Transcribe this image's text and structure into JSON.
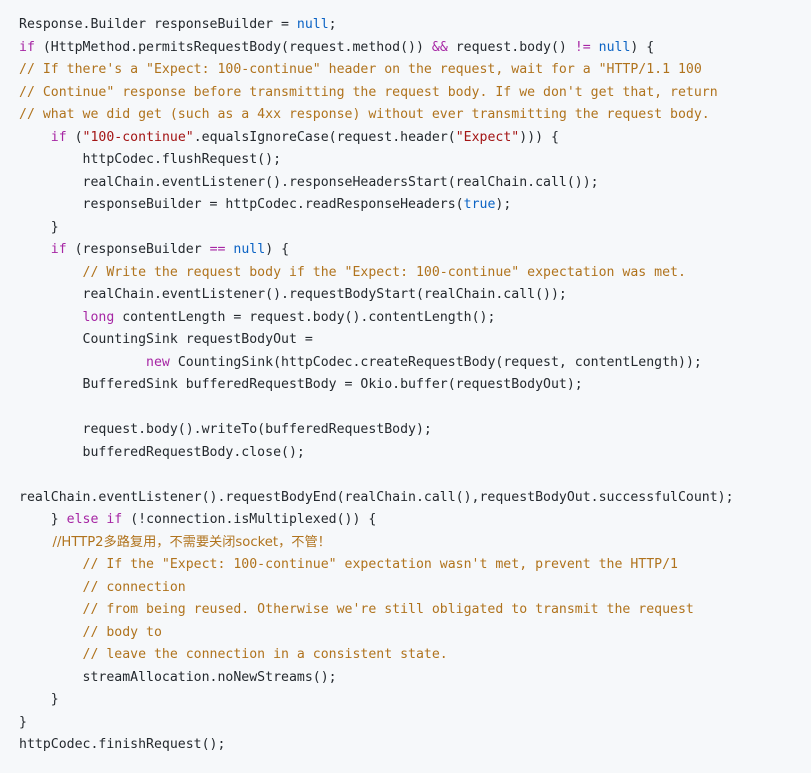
{
  "code": {
    "language": "java",
    "colors": {
      "background": "#f6f8fa",
      "text": "#24292e",
      "keyword": "#a626a4",
      "keyword_blue": "#0b63c4",
      "string": "#a31515",
      "comment": "#b0731d"
    },
    "lines": [
      [
        {
          "t": "Response.Builder responseBuilder = ",
          "c": "plain"
        },
        {
          "t": "null",
          "c": "kw2"
        },
        {
          "t": ";",
          "c": "plain"
        }
      ],
      [
        {
          "t": "if",
          "c": "kw"
        },
        {
          "t": " (HttpMethod.permitsRequestBody(request.method()) ",
          "c": "plain"
        },
        {
          "t": "&&",
          "c": "kw"
        },
        {
          "t": " request.body() ",
          "c": "plain"
        },
        {
          "t": "!=",
          "c": "kw"
        },
        {
          "t": " ",
          "c": "plain"
        },
        {
          "t": "null",
          "c": "kw2"
        },
        {
          "t": ") {",
          "c": "plain"
        }
      ],
      [
        {
          "t": "// If there's a \"Expect: 100-continue\" header on the request, wait for a \"HTTP/1.1 100",
          "c": "cmt"
        }
      ],
      [
        {
          "t": "// Continue\" response before transmitting the request body. If we don't get that, return",
          "c": "cmt"
        }
      ],
      [
        {
          "t": "// what we did get (such as a 4xx response) without ever transmitting the request body.",
          "c": "cmt"
        }
      ],
      [
        {
          "t": "    ",
          "c": "plain"
        },
        {
          "t": "if",
          "c": "kw"
        },
        {
          "t": " (",
          "c": "plain"
        },
        {
          "t": "\"100-continue\"",
          "c": "str"
        },
        {
          "t": ".equalsIgnoreCase(request.header(",
          "c": "plain"
        },
        {
          "t": "\"Expect\"",
          "c": "str"
        },
        {
          "t": "))) {",
          "c": "plain"
        }
      ],
      [
        {
          "t": "        httpCodec.flushRequest();",
          "c": "plain"
        }
      ],
      [
        {
          "t": "        realChain.eventListener().responseHeadersStart(realChain.call());",
          "c": "plain"
        }
      ],
      [
        {
          "t": "        responseBuilder = httpCodec.readResponseHeaders(",
          "c": "plain"
        },
        {
          "t": "true",
          "c": "bool"
        },
        {
          "t": ");",
          "c": "plain"
        }
      ],
      [
        {
          "t": "    }",
          "c": "plain"
        }
      ],
      [
        {
          "t": "    ",
          "c": "plain"
        },
        {
          "t": "if",
          "c": "kw"
        },
        {
          "t": " (responseBuilder ",
          "c": "plain"
        },
        {
          "t": "==",
          "c": "kw"
        },
        {
          "t": " ",
          "c": "plain"
        },
        {
          "t": "null",
          "c": "kw2"
        },
        {
          "t": ") {",
          "c": "plain"
        }
      ],
      [
        {
          "t": "        // Write the request body if the \"Expect: 100-continue\" expectation was met.",
          "c": "cmt"
        }
      ],
      [
        {
          "t": "        realChain.eventListener().requestBodyStart(realChain.call());",
          "c": "plain"
        }
      ],
      [
        {
          "t": "        ",
          "c": "plain"
        },
        {
          "t": "long",
          "c": "kw"
        },
        {
          "t": " contentLength = request.body().contentLength();",
          "c": "plain"
        }
      ],
      [
        {
          "t": "        CountingSink requestBodyOut =",
          "c": "plain"
        }
      ],
      [
        {
          "t": "                ",
          "c": "plain"
        },
        {
          "t": "new",
          "c": "kw"
        },
        {
          "t": " CountingSink(httpCodec.createRequestBody(request, contentLength));",
          "c": "plain"
        }
      ],
      [
        {
          "t": "        BufferedSink bufferedRequestBody = Okio.buffer(requestBodyOut);",
          "c": "plain"
        }
      ],
      [
        {
          "t": "",
          "c": "plain"
        }
      ],
      [
        {
          "t": "        request.body().writeTo(bufferedRequestBody);",
          "c": "plain"
        }
      ],
      [
        {
          "t": "        bufferedRequestBody.close();",
          "c": "plain"
        }
      ],
      [
        {
          "t": "",
          "c": "plain"
        }
      ],
      [
        {
          "t": "realChain.eventListener().requestBodyEnd(realChain.call(),requestBodyOut.successfulCount);",
          "c": "plain"
        }
      ],
      [
        {
          "t": "    } ",
          "c": "plain"
        },
        {
          "t": "else",
          "c": "kw"
        },
        {
          "t": " ",
          "c": "plain"
        },
        {
          "t": "if",
          "c": "kw"
        },
        {
          "t": " (!connection.isMultiplexed()) {",
          "c": "plain"
        }
      ],
      [
        {
          "t": "        //HTTP2多路复用，不需要关闭socket，不管！",
          "c": "cmt-cn"
        }
      ],
      [
        {
          "t": "        // If the \"Expect: 100-continue\" expectation wasn't met, prevent the HTTP/1",
          "c": "cmt"
        }
      ],
      [
        {
          "t": "        // connection",
          "c": "cmt"
        }
      ],
      [
        {
          "t": "        // from being reused. Otherwise we're still obligated to transmit the request",
          "c": "cmt"
        }
      ],
      [
        {
          "t": "        // body to",
          "c": "cmt"
        }
      ],
      [
        {
          "t": "        // leave the connection in a consistent state.",
          "c": "cmt"
        }
      ],
      [
        {
          "t": "        streamAllocation.noNewStreams();",
          "c": "plain"
        }
      ],
      [
        {
          "t": "    }",
          "c": "plain"
        }
      ],
      [
        {
          "t": "}",
          "c": "plain"
        }
      ],
      [
        {
          "t": "httpCodec.finishRequest();",
          "c": "plain"
        }
      ]
    ]
  }
}
